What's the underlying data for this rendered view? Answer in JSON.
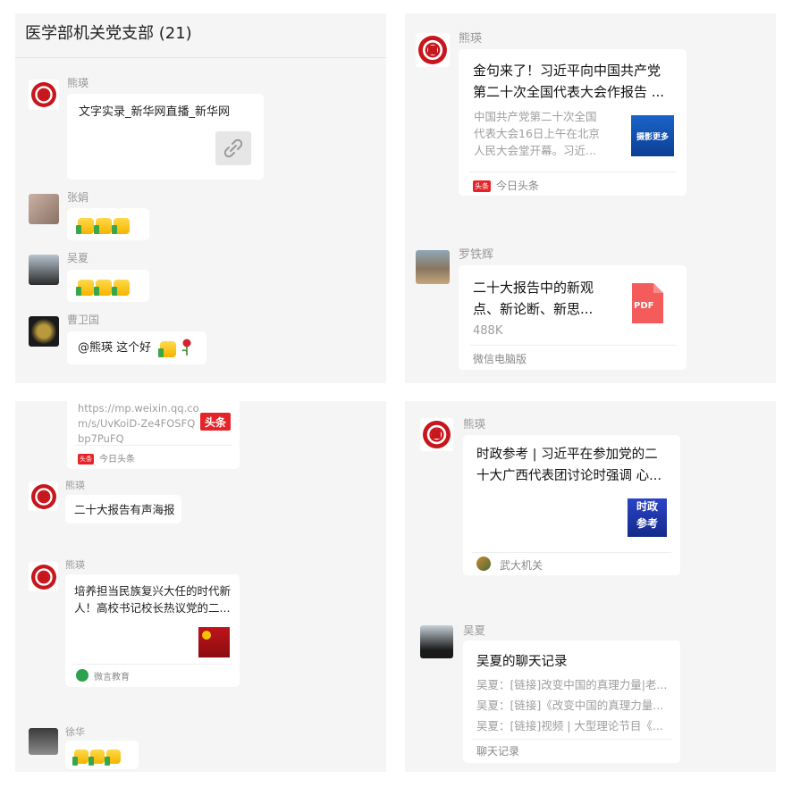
{
  "panel1": {
    "title": "医学部机关党支部 (21)",
    "msg1": {
      "sender": "熊瑛",
      "text": "文字实录_新华网直播_新华网",
      "icon": "link-icon"
    },
    "msg2": {
      "sender": "张娟",
      "emoji": "thumbs-up-icon"
    },
    "msg3": {
      "sender": "吴夏",
      "emoji": "thumbs-up-icon"
    },
    "msg4": {
      "sender": "曹卫国",
      "text": "@熊瑛 这个好",
      "emoji": [
        "thumbs-up-icon",
        "rose-icon"
      ]
    }
  },
  "panel2": {
    "msg1": {
      "sender": "熊瑛",
      "title_line1": "金句来了！习近平向中国共产党",
      "title_line2": "第二十次全国代表大会作报告 ...",
      "desc_line1": "中国共产党第二十次全国",
      "desc_line2": "代表大会16日上午在北京",
      "desc_line3": "人民大会堂开幕。习近...",
      "thumb_text": "摄影更多",
      "source_badge": "头条",
      "source": "今日头条"
    },
    "msg2": {
      "sender": "罗铁辉",
      "title_line1": "二十大报告中的新观",
      "title_line2": "点、新论断、新思...",
      "size": "488K",
      "file_icon_label": "PDF",
      "source": "微信电脑版"
    }
  },
  "panel3": {
    "msg0": {
      "url_line1": "https://mp.weixin.qq.co",
      "url_line2": "m/s/UvKoiD-Ze4FOSFQ",
      "url_line3": "bp7PuFQ",
      "logo_text": "头条",
      "source_badge": "头条",
      "source": "今日头条"
    },
    "msg1": {
      "sender": "熊瑛",
      "text": "二十大报告有声海报"
    },
    "msg2": {
      "sender": "熊瑛",
      "title_line1": "培养担当民族复兴大任的时代新",
      "title_line2": "人！高校书记校长热议党的二...",
      "source": "微言教育"
    },
    "msg3": {
      "sender": "徐华",
      "emoji": "thumbs-up-icon"
    }
  },
  "panel4": {
    "msg1": {
      "sender": "熊瑛",
      "title_line1": "时政参考 | 习近平在参加党的二",
      "title_line2": "十大广西代表团讨论时强调 心...",
      "thumb_line1": "时政",
      "thumb_line2": "参考",
      "source": "武大机关"
    },
    "msg2": {
      "sender": "吴夏",
      "title": "吴夏的聊天记录",
      "line1": "吴夏：[链接]改变中国的真理力量|老...",
      "line2": "吴夏：[链接]《改变中国的真理力量...",
      "line3": "吴夏：[链接]视频 | 大型理论节目《...",
      "footer": "聊天记录"
    }
  },
  "colors": {
    "panel_bg": "#f5f5f5",
    "bubble_bg": "#ffffff",
    "accent_red": "#e5242a",
    "pdf_red": "#f45b5b"
  }
}
